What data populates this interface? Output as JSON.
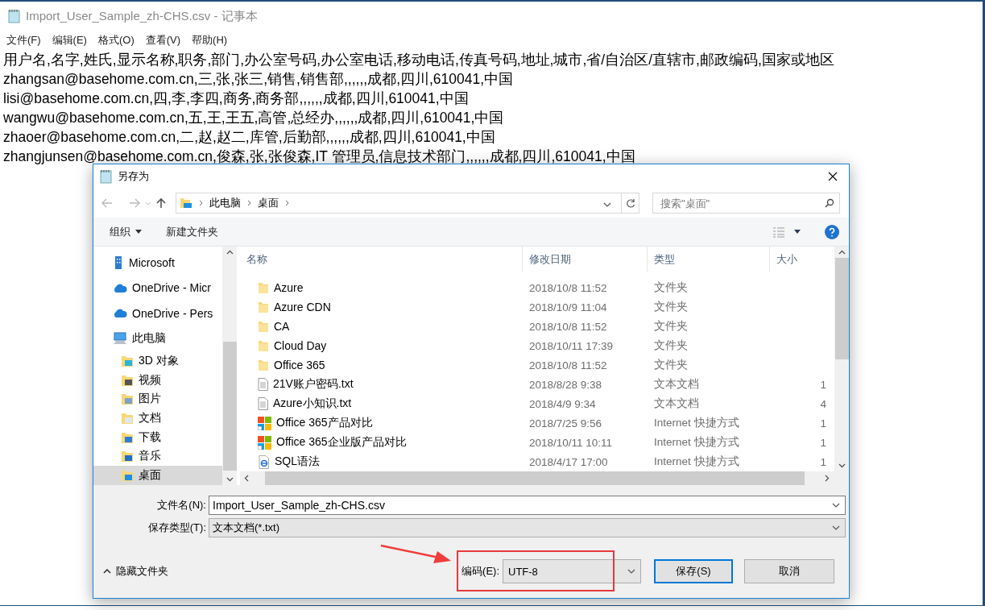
{
  "notepad": {
    "title": "Import_User_Sample_zh-CHS.csv - 记事本",
    "menu": [
      "文件(F)",
      "编辑(E)",
      "格式(O)",
      "查看(V)",
      "帮助(H)"
    ],
    "lines": [
      "用户名,名字,姓氏,显示名称,职务,部门,办公室号码,办公室电话,移动电话,传真号码,地址,城市,省/自治区/直辖市,邮政编码,国家或地区",
      "zhangsan@basehome.com.cn,三,张,张三,销售,销售部,,,,,,成都,四川,610041,中国",
      "lisi@basehome.com.cn,四,李,李四,商务,商务部,,,,,,成都,四川,610041,中国",
      "wangwu@basehome.com.cn,五,王,王五,高管,总经办,,,,,,成都,四川,610041,中国",
      "zhaoer@basehome.com.cn,二,赵,赵二,库管,后勤部,,,,,,成都,四川,610041,中国",
      "zhangjunsen@basehome.com.cn,俊森,张,张俊森,IT 管理员,信息技术部门,,,,,,成都,四川,610041,中国"
    ]
  },
  "dialog": {
    "title": "另存为",
    "breadcrumbs": [
      "此电脑",
      "桌面"
    ],
    "search": {
      "placeholder": "搜索\"桌面\""
    },
    "toolbar": {
      "organize": "组织",
      "new_folder": "新建文件夹"
    },
    "nav": [
      {
        "label": "Microsoft",
        "kind": "building",
        "selected": false
      },
      {
        "label": "OneDrive - Micr",
        "kind": "cloud",
        "selected": false
      },
      {
        "label": "OneDrive - Pers",
        "kind": "cloud",
        "selected": false
      },
      {
        "label": "此电脑",
        "kind": "computer",
        "selected": false,
        "children": [
          {
            "label": "3D 对象",
            "kind": "cube",
            "selected": false
          },
          {
            "label": "视频",
            "kind": "video",
            "selected": false
          },
          {
            "label": "图片",
            "kind": "image",
            "selected": false
          },
          {
            "label": "文档",
            "kind": "document",
            "selected": false
          },
          {
            "label": "下载",
            "kind": "download",
            "selected": false
          },
          {
            "label": "音乐",
            "kind": "music",
            "selected": false
          },
          {
            "label": "桌面",
            "kind": "desktop",
            "selected": true
          }
        ]
      }
    ],
    "columns": [
      "名称",
      "修改日期",
      "类型",
      "大小"
    ],
    "files": [
      {
        "kind": "folder",
        "name": "Azure",
        "date": "2018/10/8 11:52",
        "type": "文件夹"
      },
      {
        "kind": "folder",
        "name": "Azure CDN",
        "date": "2018/10/9 11:04",
        "type": "文件夹"
      },
      {
        "kind": "folder",
        "name": "CA",
        "date": "2018/10/8 11:52",
        "type": "文件夹"
      },
      {
        "kind": "folder",
        "name": "Cloud Day",
        "date": "2018/10/11 17:39",
        "type": "文件夹"
      },
      {
        "kind": "folder",
        "name": "Office 365",
        "date": "2018/10/8 11:52",
        "type": "文件夹"
      },
      {
        "kind": "text",
        "name": "21V账户密码.txt",
        "date": "2018/8/28 9:38",
        "type": "文本文档",
        "size": "1"
      },
      {
        "kind": "text",
        "name": "Azure小知识.txt",
        "date": "2018/4/9 9:34",
        "type": "文本文档",
        "size": "4"
      },
      {
        "kind": "office",
        "name": "Office 365产品对比",
        "date": "2018/7/25 9:56",
        "type": "Internet 快捷方式",
        "size": "1"
      },
      {
        "kind": "office",
        "name": "Office 365企业版产品对比",
        "date": "2018/10/11 10:11",
        "type": "Internet 快捷方式",
        "size": "1"
      },
      {
        "kind": "web",
        "name": "SQL语法",
        "date": "2018/4/17 17:00",
        "type": "Internet 快捷方式",
        "size": "1"
      }
    ],
    "filename": {
      "label": "文件名(N):",
      "value": "Import_User_Sample_zh-CHS.csv"
    },
    "save_type": {
      "label": "保存类型(T):",
      "value": "文本文档(*.txt)"
    },
    "hide_folders": "隐藏文件夹",
    "encoding": {
      "label": "编码(E):",
      "value": "UTF-8"
    },
    "buttons": [
      {
        "label": "保存(S)",
        "focused": true
      },
      {
        "label": "取消",
        "focused": false
      }
    ]
  }
}
